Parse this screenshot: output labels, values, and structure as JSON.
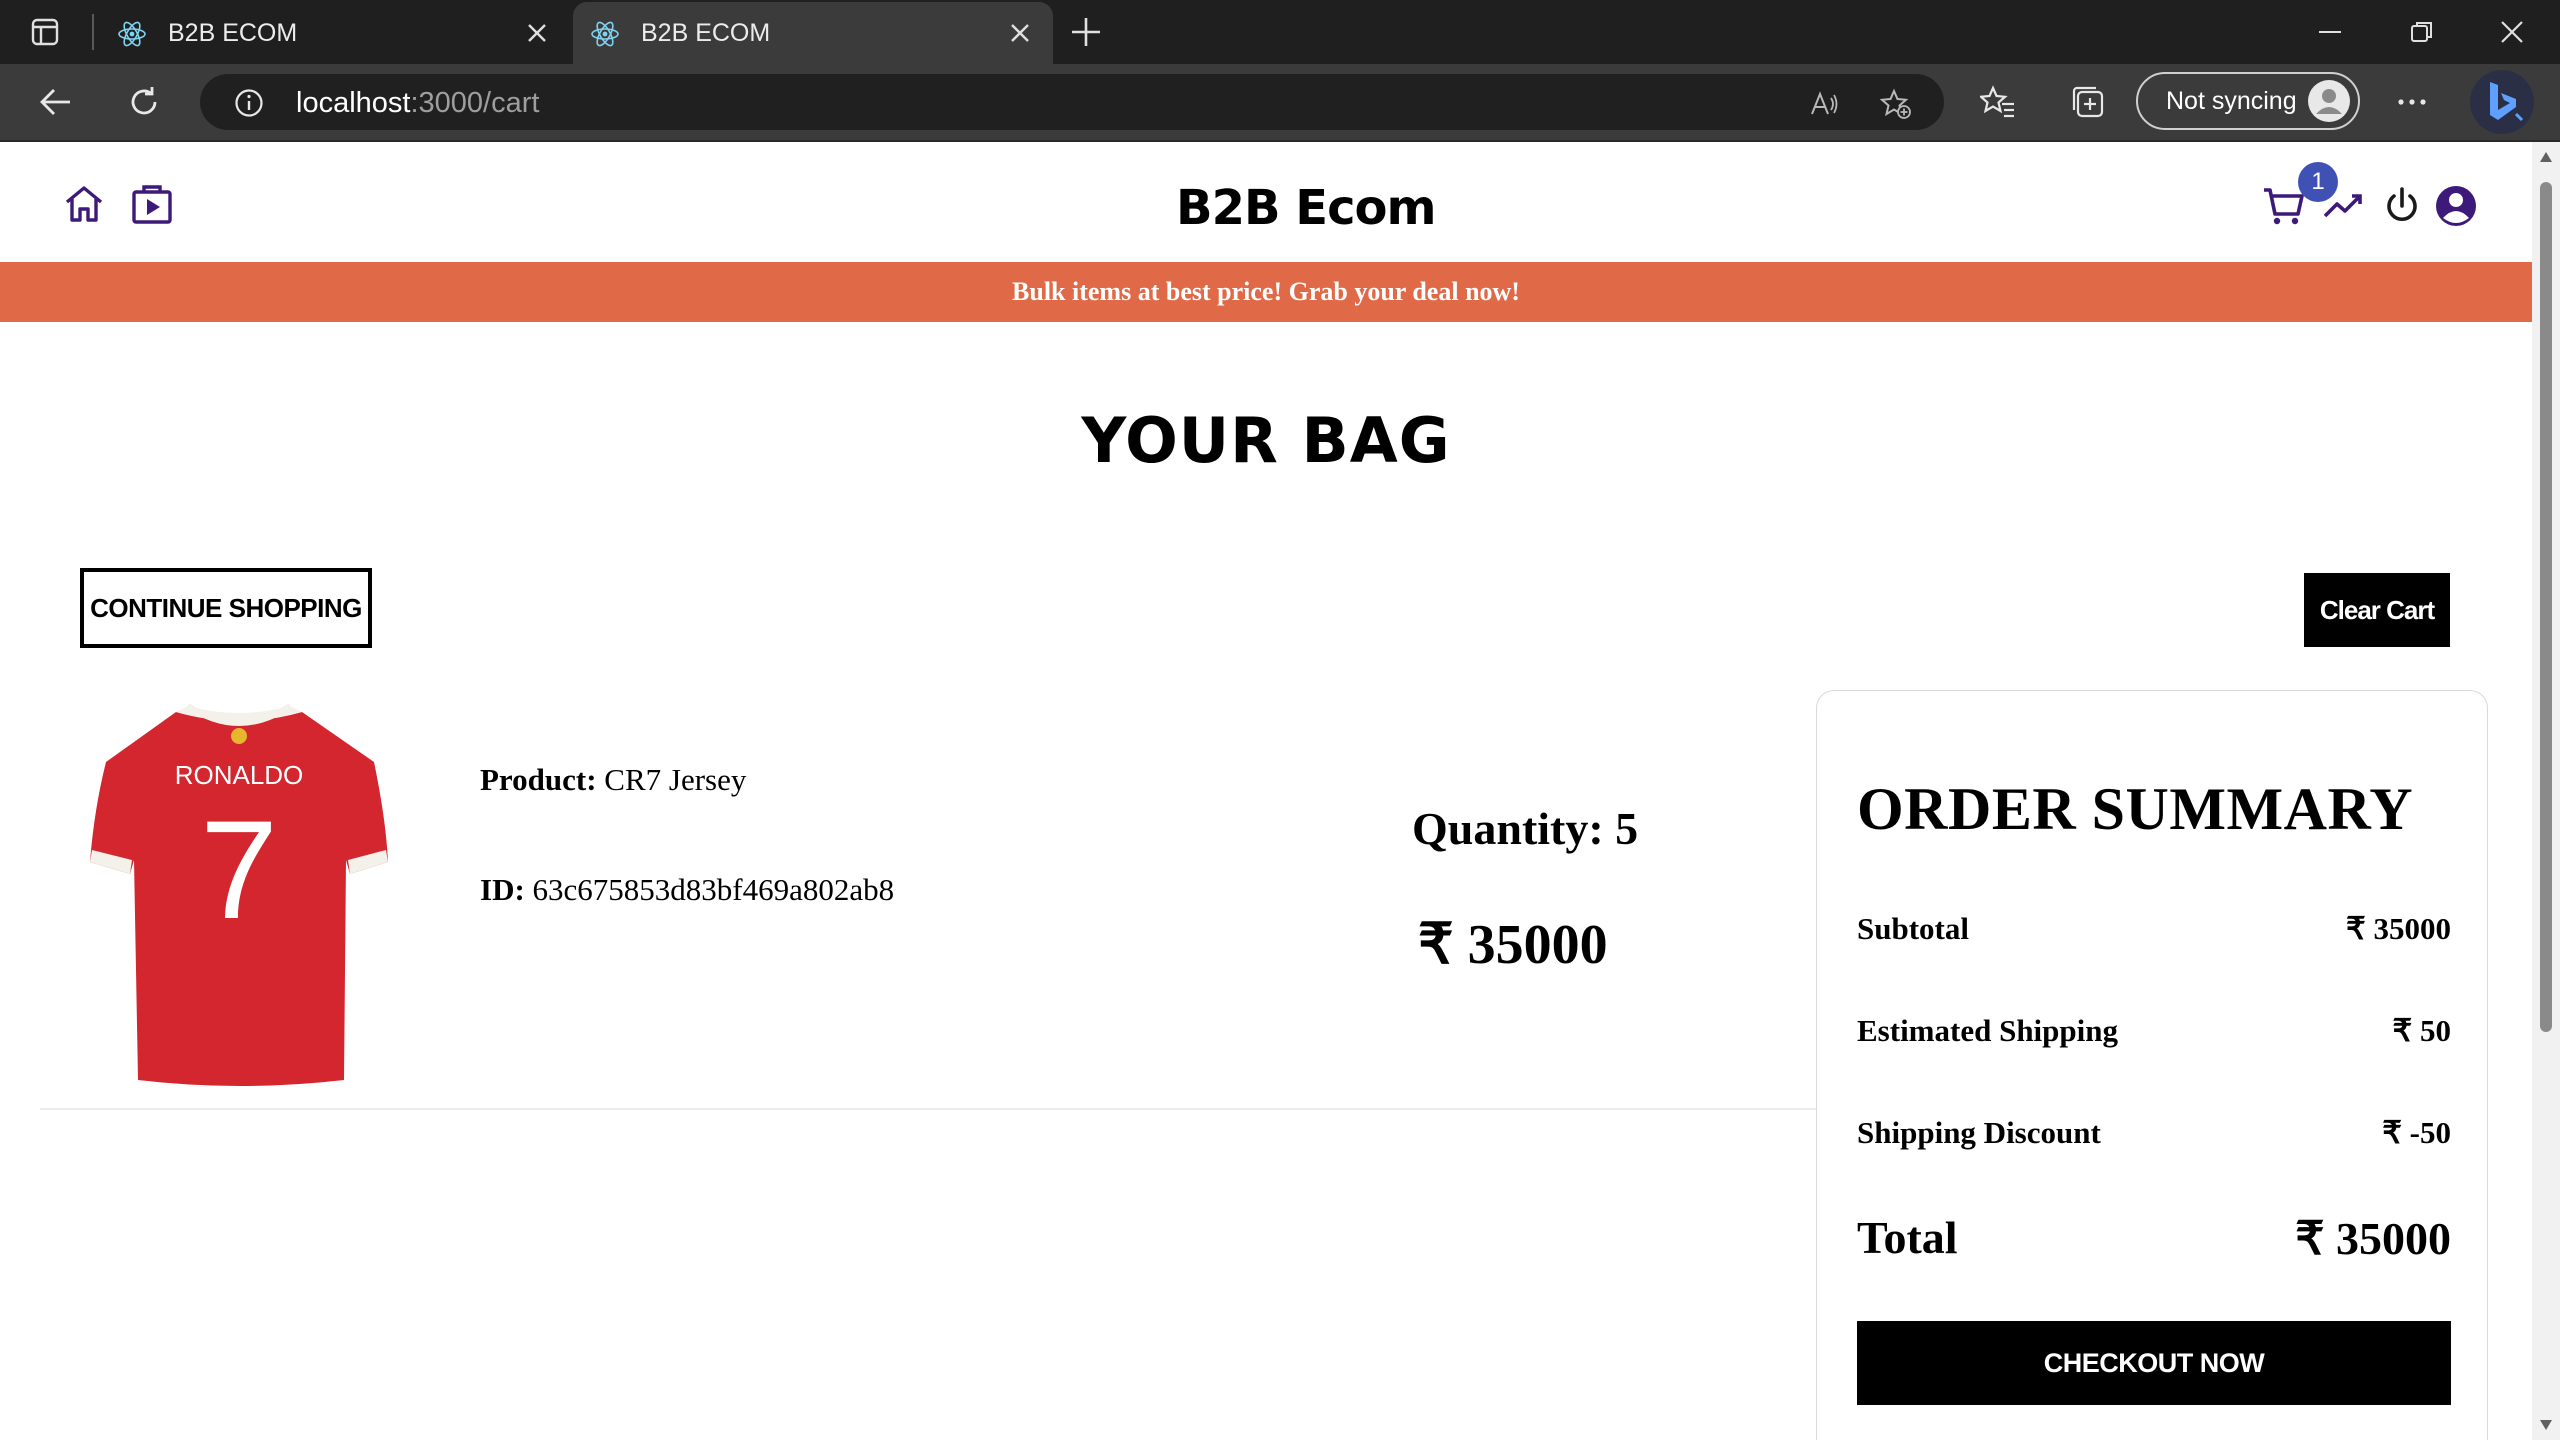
{
  "browser": {
    "tabs": [
      {
        "title": "B2B ECOM",
        "active": false
      },
      {
        "title": "B2B ECOM",
        "active": true
      }
    ],
    "url_host": "localhost",
    "url_path": ":3000/cart",
    "sync_label": "Not syncing"
  },
  "header": {
    "brand": "B2B Ecom",
    "cart_count": "1",
    "icons": [
      "home-icon",
      "video-library-icon",
      "cart-icon",
      "trending-icon",
      "power-icon",
      "account-icon"
    ],
    "accent_color": "#3d1a7a"
  },
  "announcement": {
    "text": "Bulk items at best price!  Grab your deal now!",
    "background": "#e06a48"
  },
  "bag": {
    "title": "YOUR BAG",
    "continue_label": "CONTINUE SHOPPING",
    "clear_label": "Clear Cart",
    "items": [
      {
        "product_label": "Product:",
        "product_name": "CR7 Jersey",
        "id_label": "ID:",
        "id": "63c675853d83bf469a802ab8",
        "quantity_text": "Quantity: 5",
        "price_text": "₹ 35000",
        "image_text_name": "RONALDO",
        "image_text_number": "7"
      }
    ]
  },
  "summary": {
    "title": "ORDER SUMMARY",
    "subtotal_label": "Subtotal",
    "subtotal_value": "₹ 35000",
    "shipping_label": "Estimated Shipping",
    "shipping_value": "₹ 50",
    "discount_label": "Shipping Discount",
    "discount_value": "₹ -50",
    "total_label": "Total",
    "total_value": "₹ 35000",
    "checkout_label": "CHECKOUT NOW"
  }
}
